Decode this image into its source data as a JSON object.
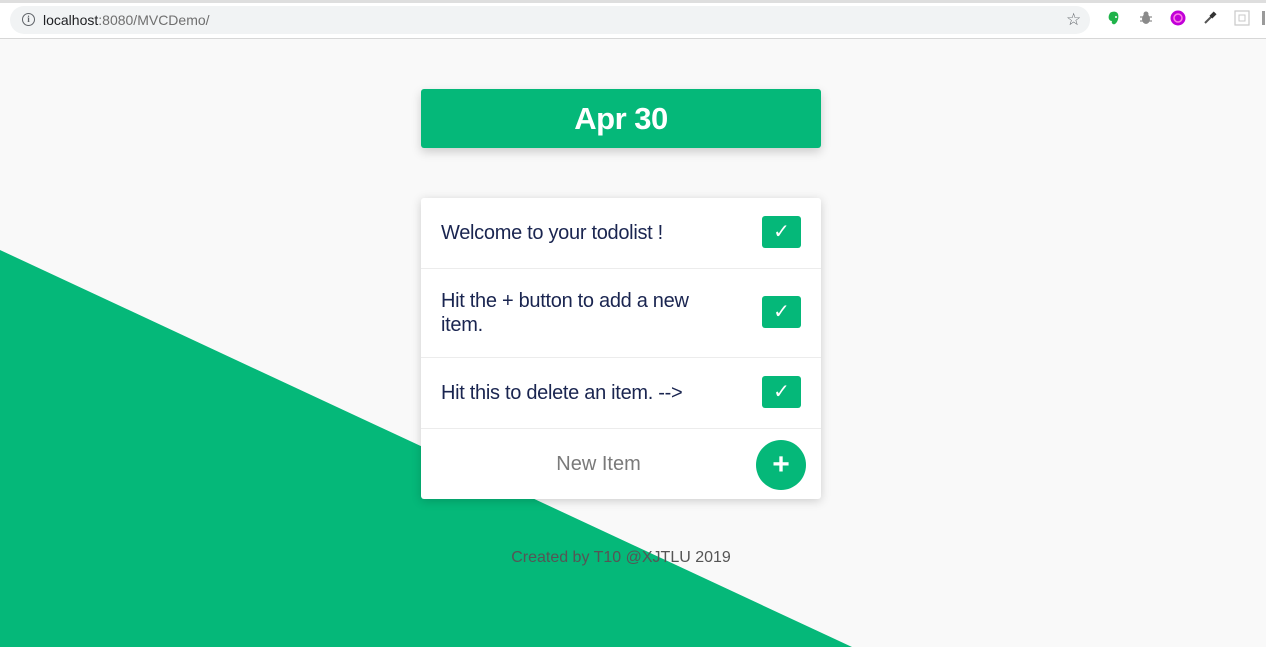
{
  "browser": {
    "url_host": "localhost",
    "url_rest": ":8080/MVCDemo/",
    "icons": [
      "info-icon",
      "bookmark-star-icon",
      "evernote-extension-icon",
      "bug-extension-icon",
      "purple-extension-icon",
      "eyedropper-extension-icon",
      "grid-extension-icon"
    ]
  },
  "header": {
    "date": "Apr 30"
  },
  "todos": [
    {
      "text": "Welcome to your todolist !",
      "check": "✓"
    },
    {
      "text": "Hit the + button to add a new item.",
      "check": "✓"
    },
    {
      "text": "Hit this to delete an item. -->",
      "check": "✓"
    }
  ],
  "new_item": {
    "placeholder": "New Item",
    "add_label": "+"
  },
  "footer": {
    "text": "Created by T10 @XJTLU 2019"
  },
  "colors": {
    "accent": "#05b879",
    "background": "#f9f9f9",
    "text": "#1a2550"
  }
}
